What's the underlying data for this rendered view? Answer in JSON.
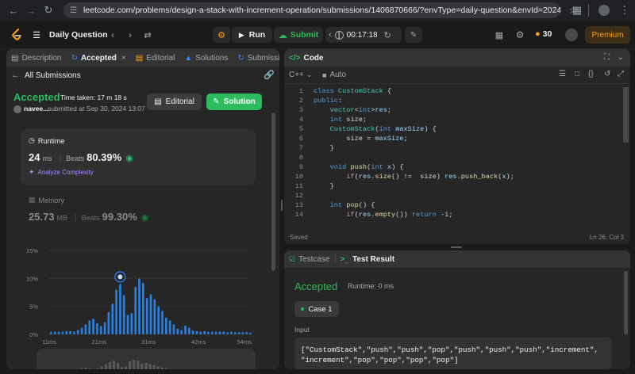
{
  "browser": {
    "url": "leetcode.com/problems/design-a-stack-with-increment-operation/submissions/1406870666/?envType=daily-question&envId=2024-09-30"
  },
  "appbar": {
    "problem_list_label": "Daily Question",
    "run_label": "Run",
    "submit_label": "Submit",
    "timer": "00:17:18",
    "streak": "30",
    "premium_label": "Premium"
  },
  "left_tabs": {
    "description": "Description",
    "accepted": "Accepted",
    "editorial": "Editorial",
    "solutions": "Solutions",
    "submissions": "Submissio"
  },
  "submission": {
    "back_label": "All Submissions",
    "status": "Accepted",
    "time_taken": "Time taken: 17 m 18 s",
    "user": "navee...",
    "submitted_at": "submitted at Sep 30, 2024 13:07",
    "editorial_button": "Editorial",
    "solution_button": "Solution",
    "runtime_title": "Runtime",
    "runtime_value": "24",
    "runtime_unit": "ms",
    "beats_label": "Beats",
    "runtime_beats": "80.39%",
    "analyze_label": "Analyze Complexity",
    "memory_title": "Memory",
    "memory_value": "25.73",
    "memory_unit": "MB",
    "memory_beats": "99.30%"
  },
  "chart_data": {
    "type": "bar",
    "y_ticks": [
      "15%",
      "10%",
      "5%",
      "0%"
    ],
    "x_ticks": [
      "11ms",
      "21ms",
      "31ms",
      "42ms",
      "54ms"
    ],
    "ylim": [
      0,
      15
    ],
    "highlight_index": 18,
    "values": [
      0.5,
      0.5,
      0.5,
      0.5,
      0.6,
      0.6,
      0.5,
      0.8,
      1.2,
      1.8,
      2.5,
      2.8,
      2.0,
      1.5,
      2.2,
      4.0,
      5.5,
      8.0,
      9.0,
      7.0,
      3.5,
      3.8,
      8.5,
      10.0,
      9.2,
      6.5,
      7.2,
      6.3,
      5.0,
      4.2,
      3.0,
      2.5,
      1.8,
      1.0,
      0.8,
      1.6,
      1.2,
      0.7,
      0.6,
      0.5,
      0.6,
      0.5,
      0.5,
      0.5,
      0.5,
      0.5,
      0.4,
      0.5,
      0.4,
      0.4,
      0.4,
      0.4,
      0.3
    ]
  },
  "code_panel": {
    "title": "Code",
    "language": "C++",
    "auto_label": "Auto",
    "status_left": "Saved",
    "status_right": "Ln 26, Col 3",
    "lines": [
      {
        "n": "1",
        "t": "class CustomStack {"
      },
      {
        "n": "2",
        "t": "public:"
      },
      {
        "n": "3",
        "t": "    vector<int>res;"
      },
      {
        "n": "4",
        "t": "    int size;"
      },
      {
        "n": "5",
        "t": "    CustomStack(int maxSize) {"
      },
      {
        "n": "6",
        "t": "        size = maxSize;"
      },
      {
        "n": "7",
        "t": "    }"
      },
      {
        "n": "8",
        "t": ""
      },
      {
        "n": "9",
        "t": "    void push(int x) {"
      },
      {
        "n": "10",
        "t": "        if(res.size() !=  size) res.push_back(x);"
      },
      {
        "n": "11",
        "t": "    }"
      },
      {
        "n": "12",
        "t": ""
      },
      {
        "n": "13",
        "t": "    int pop() {"
      },
      {
        "n": "14",
        "t": "        if(res.empty()) return -1;"
      }
    ]
  },
  "result_panel": {
    "testcase_tab": "Testcase",
    "result_tab": "Test Result",
    "status": "Accepted",
    "runtime": "Runtime: 0 ms",
    "case_label": "Case 1",
    "input_label": "Input",
    "input_line1": "[\"CustomStack\",\"push\",\"push\",\"pop\",\"push\",\"push\",\"push\",\"increment\",",
    "input_line2": "\"increment\",\"pop\",\"pop\",\"pop\",\"pop\"]"
  },
  "colors": {
    "accent_green": "#2cbb5d",
    "bar_blue": "#2a7fe0",
    "streak_orange": "#ffa116"
  }
}
